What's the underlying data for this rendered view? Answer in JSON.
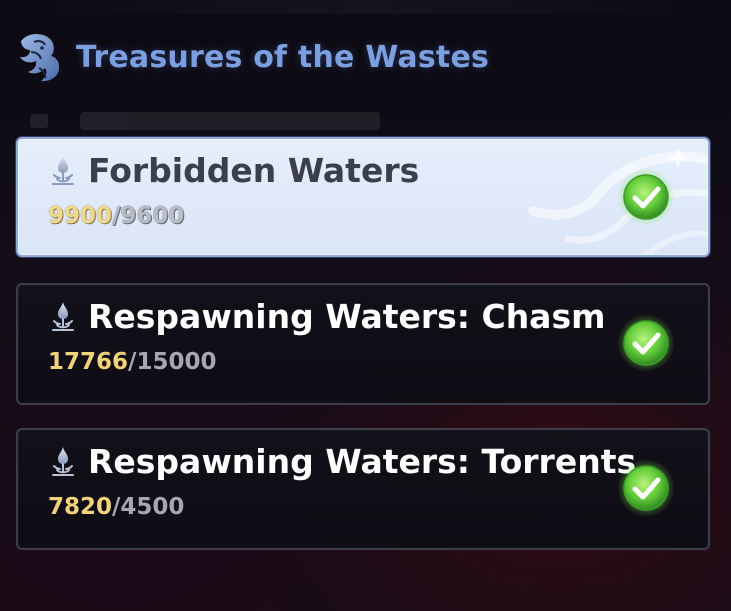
{
  "panel": {
    "title": "Treasures of the Wastes",
    "header_icon": "dragon-emblem-icon"
  },
  "colors": {
    "title_blue": "#7c9fe0",
    "progress_current": "#f2d27a",
    "progress_target": "#a7a7ad",
    "check_green": "#5ec93c",
    "selected_card_bg": "#dae5f7"
  },
  "objectives": [
    {
      "name": "Forbidden Waters",
      "current": "9900",
      "separator": "/",
      "target": "9600",
      "completed": true,
      "selected": true,
      "icon": "waterdrop-icon",
      "status_icon": "checkmark-icon"
    },
    {
      "name": "Respawning Waters: Chasm",
      "current": "17766",
      "separator": "/",
      "target": "15000",
      "completed": true,
      "selected": false,
      "icon": "waterdrop-icon",
      "status_icon": "checkmark-icon"
    },
    {
      "name": "Respawning Waters: Torrents",
      "current": "7820",
      "separator": "/",
      "target": "4500",
      "completed": true,
      "selected": false,
      "icon": "waterdrop-icon",
      "status_icon": "checkmark-icon"
    }
  ]
}
